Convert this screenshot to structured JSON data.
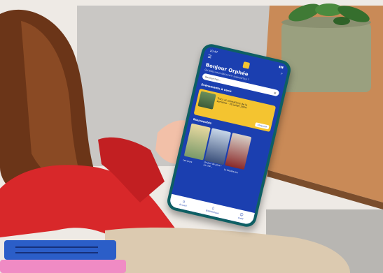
{
  "phone": {
    "status_time": "10:47",
    "greeting": "Bonjour Orphée",
    "greeting_sub": "Qu'allez-vous découvrir aujourd'hui ?",
    "search_placeholder": "Rechercher...",
    "events_title": "Événements à venir",
    "event_text": "Trocs et animations de la semaine - 30 juillet 2024",
    "event_button": "S'inscrire",
    "new_title": "Nouveautés",
    "covers": [
      {
        "caption": "Les jours"
      },
      {
        "caption": "Un jour de pluie - La Cité..."
      },
      {
        "caption": "Le Double jeu"
      }
    ],
    "tabs": [
      "Accueil",
      "Bibliothèque",
      "Profil"
    ]
  },
  "colors": {
    "screen": "#1b3fb0",
    "accent": "#f4c430",
    "phone_case": "#0e5f63",
    "sweater": "#d8282a"
  }
}
